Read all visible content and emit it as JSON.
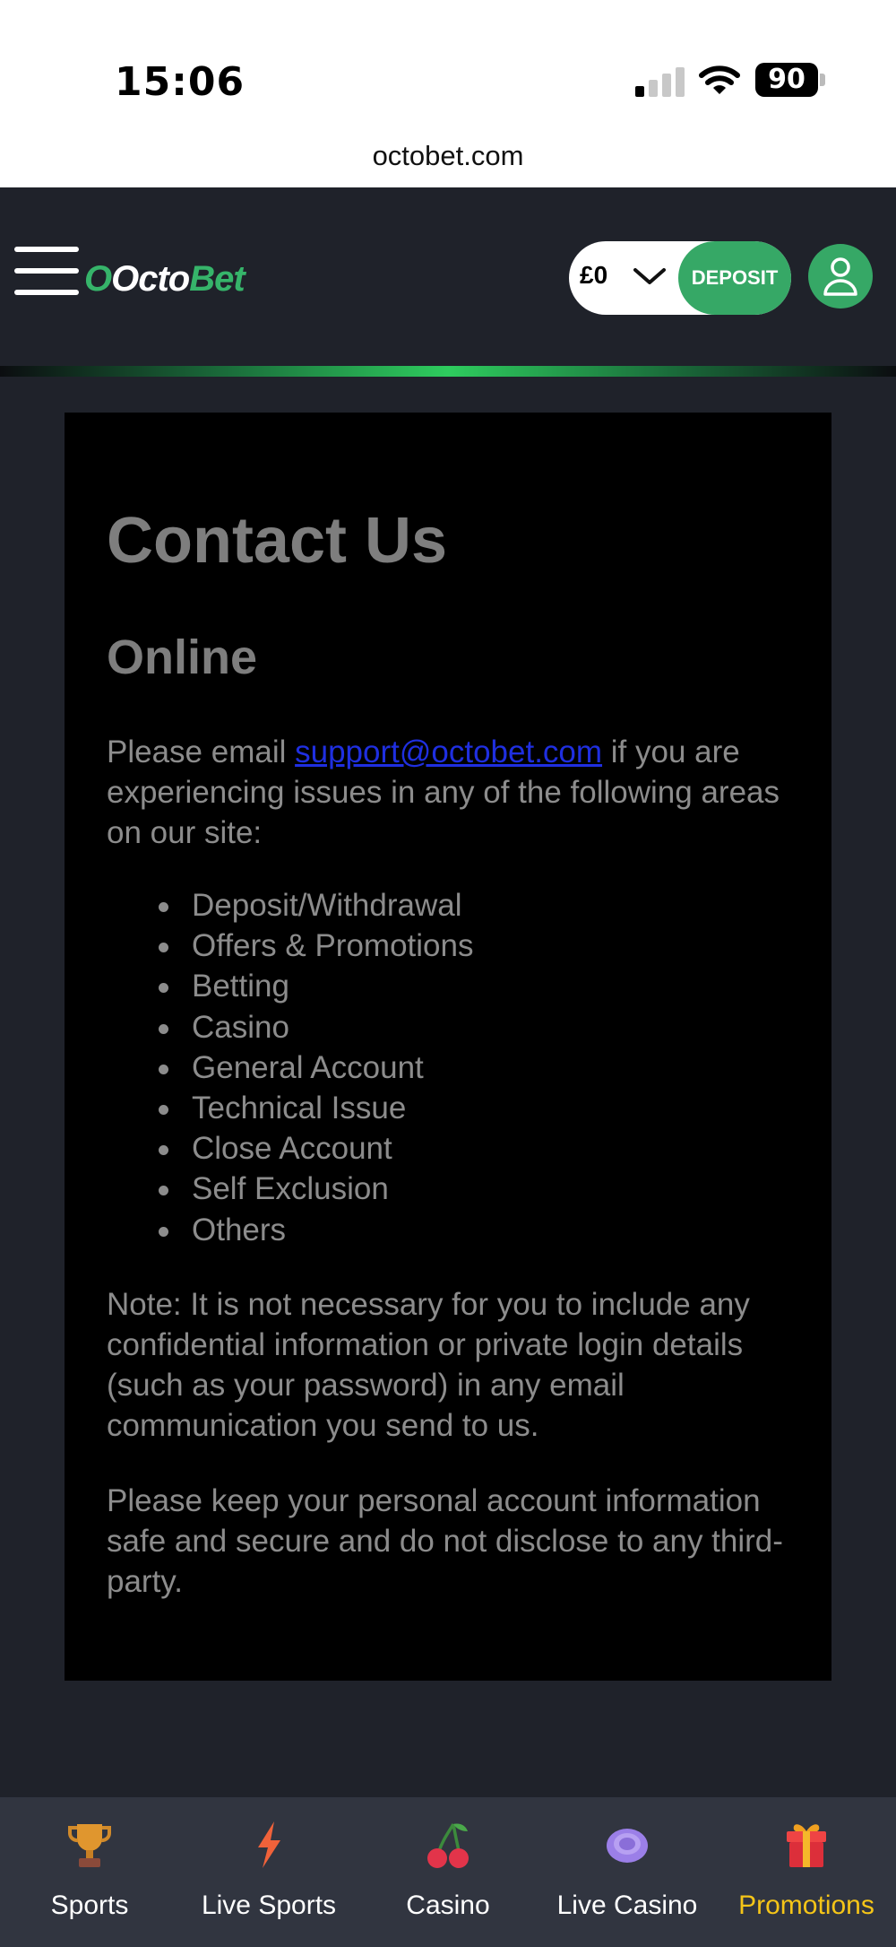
{
  "status_bar": {
    "time": "15:06",
    "battery": "90"
  },
  "browser": {
    "url": "octobet.com"
  },
  "header": {
    "logo_o": "O",
    "logo_octo": "Octo",
    "logo_bet": "Bet",
    "balance": "£0",
    "deposit_label": "DEPOSIT"
  },
  "content": {
    "title": "Contact Us",
    "subtitle": "Online",
    "intro_before": "Please email ",
    "email": "support@octobet.com",
    "intro_after": " if you are experiencing issues in any of the following areas on our site:",
    "areas": [
      "Deposit/Withdrawal",
      "Offers & Promotions",
      "Betting",
      "Casino",
      "General Account",
      "Technical Issue",
      "Close Account",
      "Self Exclusion",
      "Others"
    ],
    "note": "Note: It is not necessary for you to include any confidential information or private login details (such as your password) in any email communication you send to us.",
    "advice": "Please keep your personal account information safe and secure and do not disclose to any third-party."
  },
  "bottom_nav": {
    "items": [
      {
        "label": "Sports",
        "icon": "trophy-icon"
      },
      {
        "label": "Live Sports",
        "icon": "lightning-icon"
      },
      {
        "label": "Casino",
        "icon": "cherries-icon"
      },
      {
        "label": "Live Casino",
        "icon": "casino-chip-icon"
      },
      {
        "label": "Promotions",
        "icon": "gift-icon"
      }
    ],
    "active_color": "#f5c518"
  },
  "colors": {
    "brand_green": "#36a866",
    "background": "#1f222a",
    "card": "#000000"
  }
}
